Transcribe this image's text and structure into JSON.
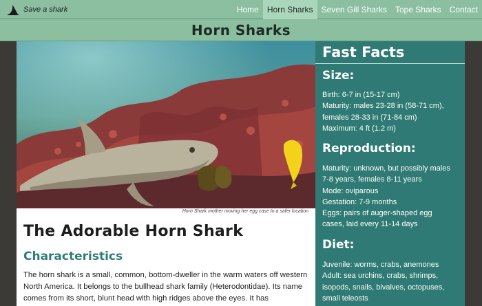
{
  "brand": {
    "name": "Save a shark",
    "logo_icon": "shark-fin-icon"
  },
  "nav": {
    "items": [
      {
        "label": "Home",
        "active": false
      },
      {
        "label": "Horn Sharks",
        "active": true
      },
      {
        "label": "Seven Gill Sharks",
        "active": false
      },
      {
        "label": "Tope Sharks",
        "active": false
      },
      {
        "label": "Contact",
        "active": false
      }
    ]
  },
  "page": {
    "title": "Horn Sharks"
  },
  "main": {
    "photo_caption": "Horn Shark mother moving her egg case to a safer location",
    "article_title": "The Adorable Horn Shark",
    "section_title": "Characteristics",
    "body": "The horn shark is a small, common, bottom-dweller in the warm waters off western North America. It belongs to the bullhead shark family (Heterodontidae). Its name comes from its short, blunt head with high ridges above the eyes. It has"
  },
  "sidebar": {
    "title": "Fast Facts",
    "size": {
      "heading": "Size:",
      "lines": [
        "Birth: 6-7 in (15-17 cm)",
        "Maturity: males 23-28 in (58-71 cm),",
        "females 28-33 in (71-84 cm)",
        "Maximum: 4 ft (1.2 m)"
      ]
    },
    "reproduction": {
      "heading": "Reproduction:",
      "lines": [
        "Maturity: unknown, but possibly males",
        "7-8 years, females 8-11 years",
        "Mode: oviparous",
        "Gestation: 7-9 months",
        "Eggs: pairs of auger-shaped egg",
        "cases, laid every 11-14 days"
      ]
    },
    "diet": {
      "heading": "Diet:",
      "lines": [
        "Juvenile: worms, crabs, anemones",
        "Adult: sea urchins, crabs, shrimps,",
        "isopods, snails, bivalves, octopuses,",
        "small teleosts"
      ]
    }
  },
  "colors": {
    "nav_bg": "#8bbfa0",
    "nav_active": "#aad7bc",
    "sidebar_bg": "#2f7a74",
    "accent_heading": "#2f7c76",
    "page_bg": "#3b3a36"
  }
}
